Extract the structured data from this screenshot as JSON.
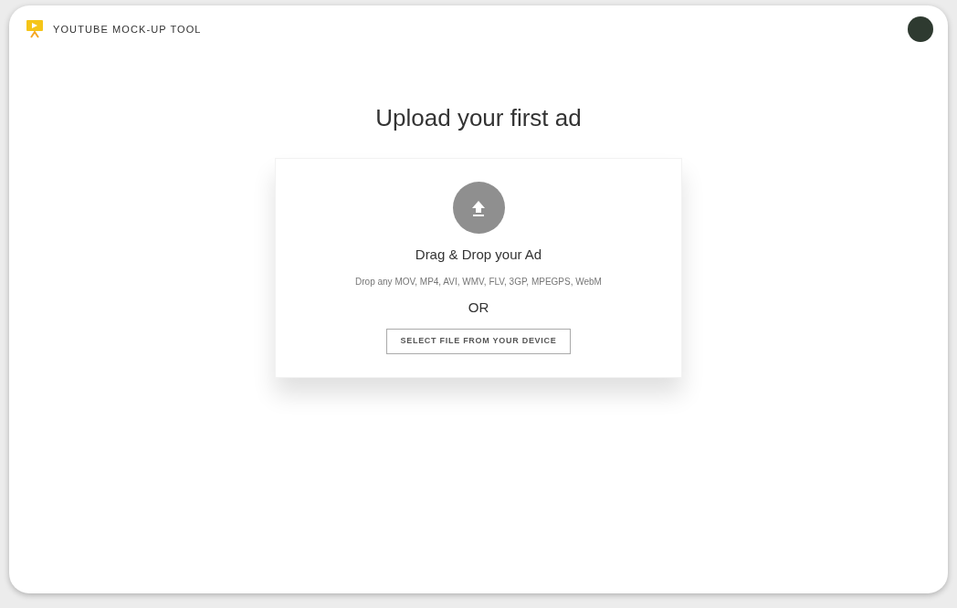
{
  "header": {
    "app_name": "YOUTUBE MOCK-UP TOOL"
  },
  "upload": {
    "title": "Upload your first ad",
    "drop_heading": "Drag & Drop your Ad",
    "formats": "Drop any MOV, MP4, AVI, WMV, FLV, 3GP, MPEGPS, WebM",
    "separator": "OR",
    "button": "SELECT FILE FROM YOUR DEVICE"
  }
}
